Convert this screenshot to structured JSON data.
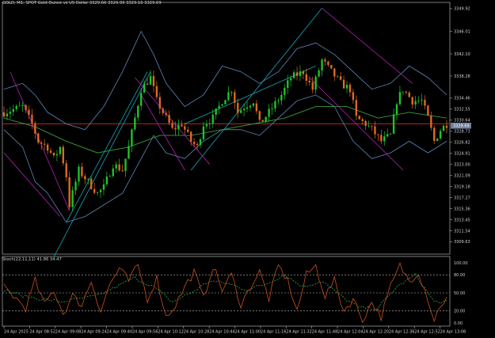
{
  "colors": {
    "background": "#000000",
    "frame": "#9a9a9a",
    "bull": "#1fc42b",
    "bear": "#e06a22",
    "bands": "#5f86b8",
    "ma": "#3c9a3c",
    "channel_cyan": "#15a8b6",
    "channel_magenta": "#b21fb2",
    "hline": "#cc2a2a",
    "stoch_main": "#c8501e",
    "stoch_signal": "#2ea84a",
    "stoch_level": "#bfbfbf",
    "axis_text": "#cfcfcf",
    "price_tag": "#6e7f99"
  },
  "header": {
    "symbol_line": "GOLD, M1:  SPOT Gold Ounce vs US Dollar  3329.66 3329.99 3329.16 3329.69"
  },
  "subwindow": {
    "label": "Stoch(22,11,11) 41.86 34.47"
  },
  "chart_data": [
    {
      "type": "candlestick",
      "ylim": [
        3307.5,
        3351.0
      ],
      "current_price_label": "3329.69",
      "horizontal_line": 3330.0,
      "y_ticks": [
        "3349.92",
        "3346.01",
        "3342.10",
        "3338.28",
        "3334.46",
        "3332.55",
        "3330.64",
        "3328.73",
        "3326.82",
        "3324.91",
        "3323.00",
        "3321.09",
        "3319.18",
        "3317.27",
        "3315.36",
        "3313.45",
        "3311.54",
        "3309.63"
      ],
      "y_tick_values": [
        3349.92,
        3346.01,
        3342.1,
        3338.28,
        3334.46,
        3332.55,
        3330.64,
        3328.73,
        3326.82,
        3324.91,
        3323.0,
        3321.09,
        3319.18,
        3317.27,
        3315.36,
        3313.45,
        3311.54,
        3309.63
      ],
      "x_ticks": [
        "24 Apr 2025",
        "24 Apr 08:52",
        "24 Apr 09:08",
        "24 Apr 09:24",
        "24 Apr 09:40",
        "24 Apr 09:56",
        "24 Apr 10:12",
        "24 Apr 10:28",
        "24 Apr 10:44",
        "24 Apr 11:00",
        "24 Apr 11:16",
        "24 Apr 11:32",
        "24 Apr 11:48",
        "24 Apr 12:04",
        "24 Apr 12:20",
        "24 Apr 12:36",
        "24 Apr 12:52",
        "24 Apr 13:08"
      ],
      "x_range_bars": 143,
      "path_anchors": [
        [
          0,
          3332
        ],
        [
          6,
          3333
        ],
        [
          9,
          3330
        ],
        [
          11,
          3327
        ],
        [
          14,
          3326
        ],
        [
          16,
          3324
        ],
        [
          18,
          3326
        ],
        [
          20,
          3321
        ],
        [
          21,
          3316
        ],
        [
          24,
          3322
        ],
        [
          27,
          3320
        ],
        [
          30,
          3318
        ],
        [
          32,
          3319
        ],
        [
          35,
          3323
        ],
        [
          38,
          3322
        ],
        [
          40,
          3326
        ],
        [
          42,
          3331
        ],
        [
          44,
          3336
        ],
        [
          47,
          3338
        ],
        [
          49,
          3334
        ],
        [
          52,
          3331
        ],
        [
          54,
          3329
        ],
        [
          57,
          3330
        ],
        [
          60,
          3327
        ],
        [
          62,
          3326
        ],
        [
          64,
          3330
        ],
        [
          67,
          3331
        ],
        [
          70,
          3334
        ],
        [
          73,
          3336
        ],
        [
          75,
          3332
        ],
        [
          77,
          3333
        ],
        [
          80,
          3334
        ],
        [
          82,
          3330
        ],
        [
          85,
          3332
        ],
        [
          89,
          3335
        ],
        [
          92,
          3338
        ],
        [
          96,
          3339
        ],
        [
          99,
          3336
        ],
        [
          102,
          3341
        ],
        [
          105,
          3339
        ],
        [
          108,
          3337
        ],
        [
          111,
          3336
        ],
        [
          113,
          3331
        ],
        [
          116,
          3330
        ],
        [
          118,
          3329
        ],
        [
          121,
          3327
        ],
        [
          124,
          3328
        ],
        [
          126,
          3334
        ],
        [
          128,
          3336
        ],
        [
          131,
          3334
        ],
        [
          134,
          3334
        ],
        [
          136,
          3331
        ],
        [
          138,
          3327
        ],
        [
          140,
          3329
        ],
        [
          142,
          3330
        ]
      ],
      "upper_band": [
        [
          0,
          3336
        ],
        [
          6,
          3337
        ],
        [
          10,
          3335
        ],
        [
          14,
          3332
        ],
        [
          20,
          3330
        ],
        [
          26,
          3329
        ],
        [
          32,
          3333
        ],
        [
          38,
          3339
        ],
        [
          44,
          3346
        ],
        [
          48,
          3342
        ],
        [
          52,
          3337
        ],
        [
          58,
          3333
        ],
        [
          64,
          3335
        ],
        [
          70,
          3340
        ],
        [
          76,
          3339
        ],
        [
          82,
          3337
        ],
        [
          88,
          3339
        ],
        [
          94,
          3343
        ],
        [
          100,
          3344
        ],
        [
          106,
          3342
        ],
        [
          112,
          3339
        ],
        [
          118,
          3336
        ],
        [
          124,
          3337
        ],
        [
          130,
          3340
        ],
        [
          136,
          3338
        ],
        [
          142,
          3335
        ]
      ],
      "lower_band": [
        [
          0,
          3329
        ],
        [
          6,
          3326
        ],
        [
          10,
          3320
        ],
        [
          14,
          3318
        ],
        [
          20,
          3313
        ],
        [
          26,
          3314
        ],
        [
          32,
          3316
        ],
        [
          38,
          3318
        ],
        [
          44,
          3324
        ],
        [
          48,
          3328
        ],
        [
          52,
          3325
        ],
        [
          58,
          3324
        ],
        [
          64,
          3327
        ],
        [
          70,
          3329
        ],
        [
          76,
          3329
        ],
        [
          82,
          3328
        ],
        [
          88,
          3331
        ],
        [
          94,
          3334
        ],
        [
          100,
          3335
        ],
        [
          106,
          3333
        ],
        [
          112,
          3327
        ],
        [
          118,
          3324
        ],
        [
          124,
          3325
        ],
        [
          130,
          3327
        ],
        [
          136,
          3325
        ],
        [
          142,
          3327
        ]
      ],
      "ma_line": [
        [
          0,
          3331
        ],
        [
          10,
          3329.5
        ],
        [
          20,
          3327
        ],
        [
          30,
          3325
        ],
        [
          40,
          3326
        ],
        [
          50,
          3328
        ],
        [
          60,
          3328
        ],
        [
          70,
          3329
        ],
        [
          80,
          3330
        ],
        [
          90,
          3331
        ],
        [
          100,
          3333
        ],
        [
          110,
          3333
        ],
        [
          120,
          3331
        ],
        [
          130,
          3332
        ],
        [
          142,
          3331
        ]
      ],
      "channels": [
        {
          "color": "channel_cyan",
          "points": [
            [
              20,
              3313
            ],
            [
              46,
              3339
            ]
          ]
        },
        {
          "color": "channel_cyan",
          "points": [
            [
              16,
              3307
            ],
            [
              47,
              3339
            ]
          ]
        },
        {
          "color": "channel_cyan",
          "points": [
            [
              60,
              3322
            ],
            [
              102,
              3350
            ]
          ]
        },
        {
          "color": "channel_cyan",
          "points": [
            [
              58,
              3330
            ],
            [
              100,
              3340
            ]
          ]
        },
        {
          "color": "channel_magenta",
          "points": [
            [
              2,
              3339
            ],
            [
              21,
              3315
            ]
          ]
        },
        {
          "color": "channel_magenta",
          "points": [
            [
              0,
              3325
            ],
            [
              18,
              3314
            ]
          ]
        },
        {
          "color": "channel_magenta",
          "points": [
            [
              42,
              3338
            ],
            [
              66,
              3323
            ]
          ]
        },
        {
          "color": "channel_magenta",
          "points": [
            [
              44,
              3335
            ],
            [
              58,
              3322
            ]
          ]
        },
        {
          "color": "channel_magenta",
          "points": [
            [
              102,
              3350
            ],
            [
              131,
              3337
            ]
          ]
        },
        {
          "color": "channel_magenta",
          "points": [
            [
              98,
              3338
            ],
            [
              128,
              3322
            ]
          ]
        }
      ],
      "stoch_levels": [
        80,
        50,
        20
      ],
      "stoch_level_labels": [
        "100.00",
        "80.00",
        "50.00",
        "20.00",
        "0.00"
      ],
      "stoch_main_anchors": [
        [
          0,
          60
        ],
        [
          4,
          40
        ],
        [
          7,
          25
        ],
        [
          10,
          70
        ],
        [
          13,
          30
        ],
        [
          16,
          55
        ],
        [
          19,
          15
        ],
        [
          22,
          45
        ],
        [
          25,
          30
        ],
        [
          28,
          70
        ],
        [
          31,
          20
        ],
        [
          34,
          65
        ],
        [
          37,
          90
        ],
        [
          40,
          70
        ],
        [
          43,
          95
        ],
        [
          46,
          40
        ],
        [
          49,
          75
        ],
        [
          52,
          10
        ],
        [
          55,
          30
        ],
        [
          58,
          60
        ],
        [
          61,
          85
        ],
        [
          64,
          40
        ],
        [
          67,
          95
        ],
        [
          70,
          55
        ],
        [
          73,
          80
        ],
        [
          76,
          30
        ],
        [
          79,
          60
        ],
        [
          82,
          85
        ],
        [
          85,
          40
        ],
        [
          88,
          95
        ],
        [
          91,
          70
        ],
        [
          94,
          20
        ],
        [
          97,
          80
        ],
        [
          100,
          95
        ],
        [
          103,
          45
        ],
        [
          106,
          70
        ],
        [
          109,
          20
        ],
        [
          112,
          40
        ],
        [
          115,
          5
        ],
        [
          118,
          35
        ],
        [
          121,
          10
        ],
        [
          124,
          60
        ],
        [
          127,
          95
        ],
        [
          130,
          70
        ],
        [
          133,
          85
        ],
        [
          136,
          40
        ],
        [
          138,
          5
        ],
        [
          140,
          30
        ],
        [
          142,
          40
        ]
      ],
      "stoch_signal_anchors": [
        [
          0,
          55
        ],
        [
          6,
          45
        ],
        [
          12,
          40
        ],
        [
          18,
          35
        ],
        [
          24,
          40
        ],
        [
          30,
          45
        ],
        [
          36,
          60
        ],
        [
          42,
          75
        ],
        [
          48,
          60
        ],
        [
          54,
          35
        ],
        [
          60,
          50
        ],
        [
          66,
          70
        ],
        [
          72,
          65
        ],
        [
          78,
          55
        ],
        [
          84,
          65
        ],
        [
          90,
          80
        ],
        [
          96,
          60
        ],
        [
          102,
          70
        ],
        [
          108,
          45
        ],
        [
          114,
          25
        ],
        [
          120,
          25
        ],
        [
          126,
          60
        ],
        [
          132,
          80
        ],
        [
          138,
          35
        ],
        [
          142,
          35
        ]
      ]
    }
  ]
}
